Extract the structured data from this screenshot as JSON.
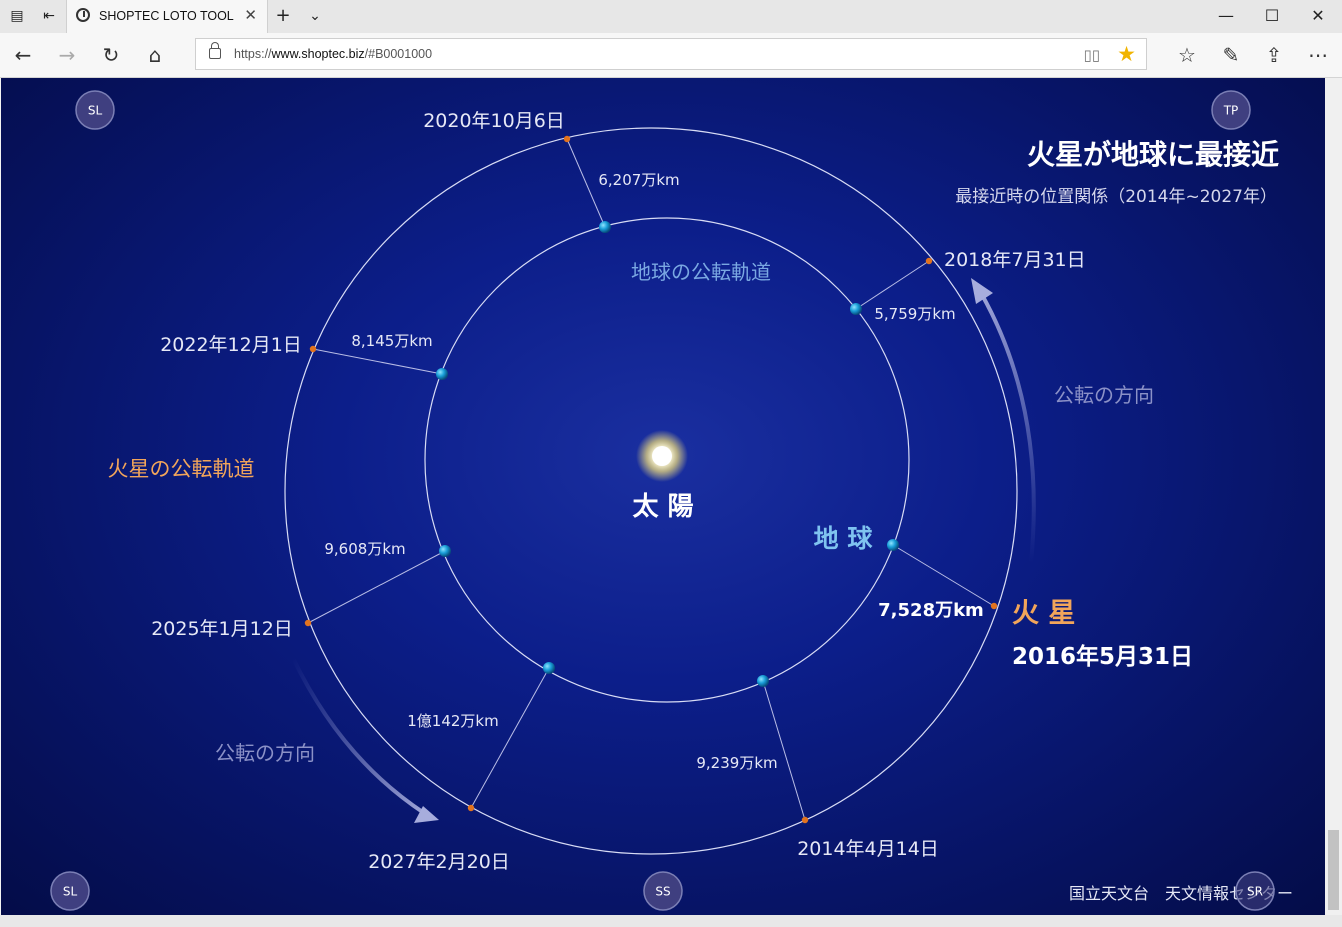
{
  "browser": {
    "tab_title": "SHOPTEC LOTO TOOL",
    "url_prefix": "https://",
    "url_host": "www.shoptec.biz",
    "url_path": "/#B0001000"
  },
  "diagram": {
    "title": "火星が地球に最接近",
    "subtitle": "最接近時の位置関係（2014年~2027年）",
    "sun_label": "太 陽",
    "earth_label": "地 球",
    "mars_label": "火 星",
    "earth_orbit_label": "地球の公転軌道",
    "mars_orbit_label": "火星の公転軌道",
    "direction_label_right": "公転の方向",
    "direction_label_left": "公転の方向",
    "credit": "国立天文台　天文情報センター",
    "approaches": [
      {
        "id": "a2014",
        "date": "2014年4月14日",
        "distance": "9,239万km"
      },
      {
        "id": "a2016",
        "date": "2016年5月31日",
        "distance": "7,528万km"
      },
      {
        "id": "a2018",
        "date": "2018年7月31日",
        "distance": "5,759万km"
      },
      {
        "id": "a2020",
        "date": "2020年10月6日",
        "distance": "6,207万km"
      },
      {
        "id": "a2022",
        "date": "2022年12月1日",
        "distance": "8,145万km"
      },
      {
        "id": "a2025",
        "date": "2025年1月12日",
        "distance": "9,608万km"
      },
      {
        "id": "a2027",
        "date": "2027年2月20日",
        "distance": "1億142万km"
      }
    ]
  },
  "corner_buttons": {
    "top_left": "SL",
    "top_right": "TP",
    "bottom_left": "SL",
    "bottom_center": "SS",
    "bottom_right": "SR"
  }
}
